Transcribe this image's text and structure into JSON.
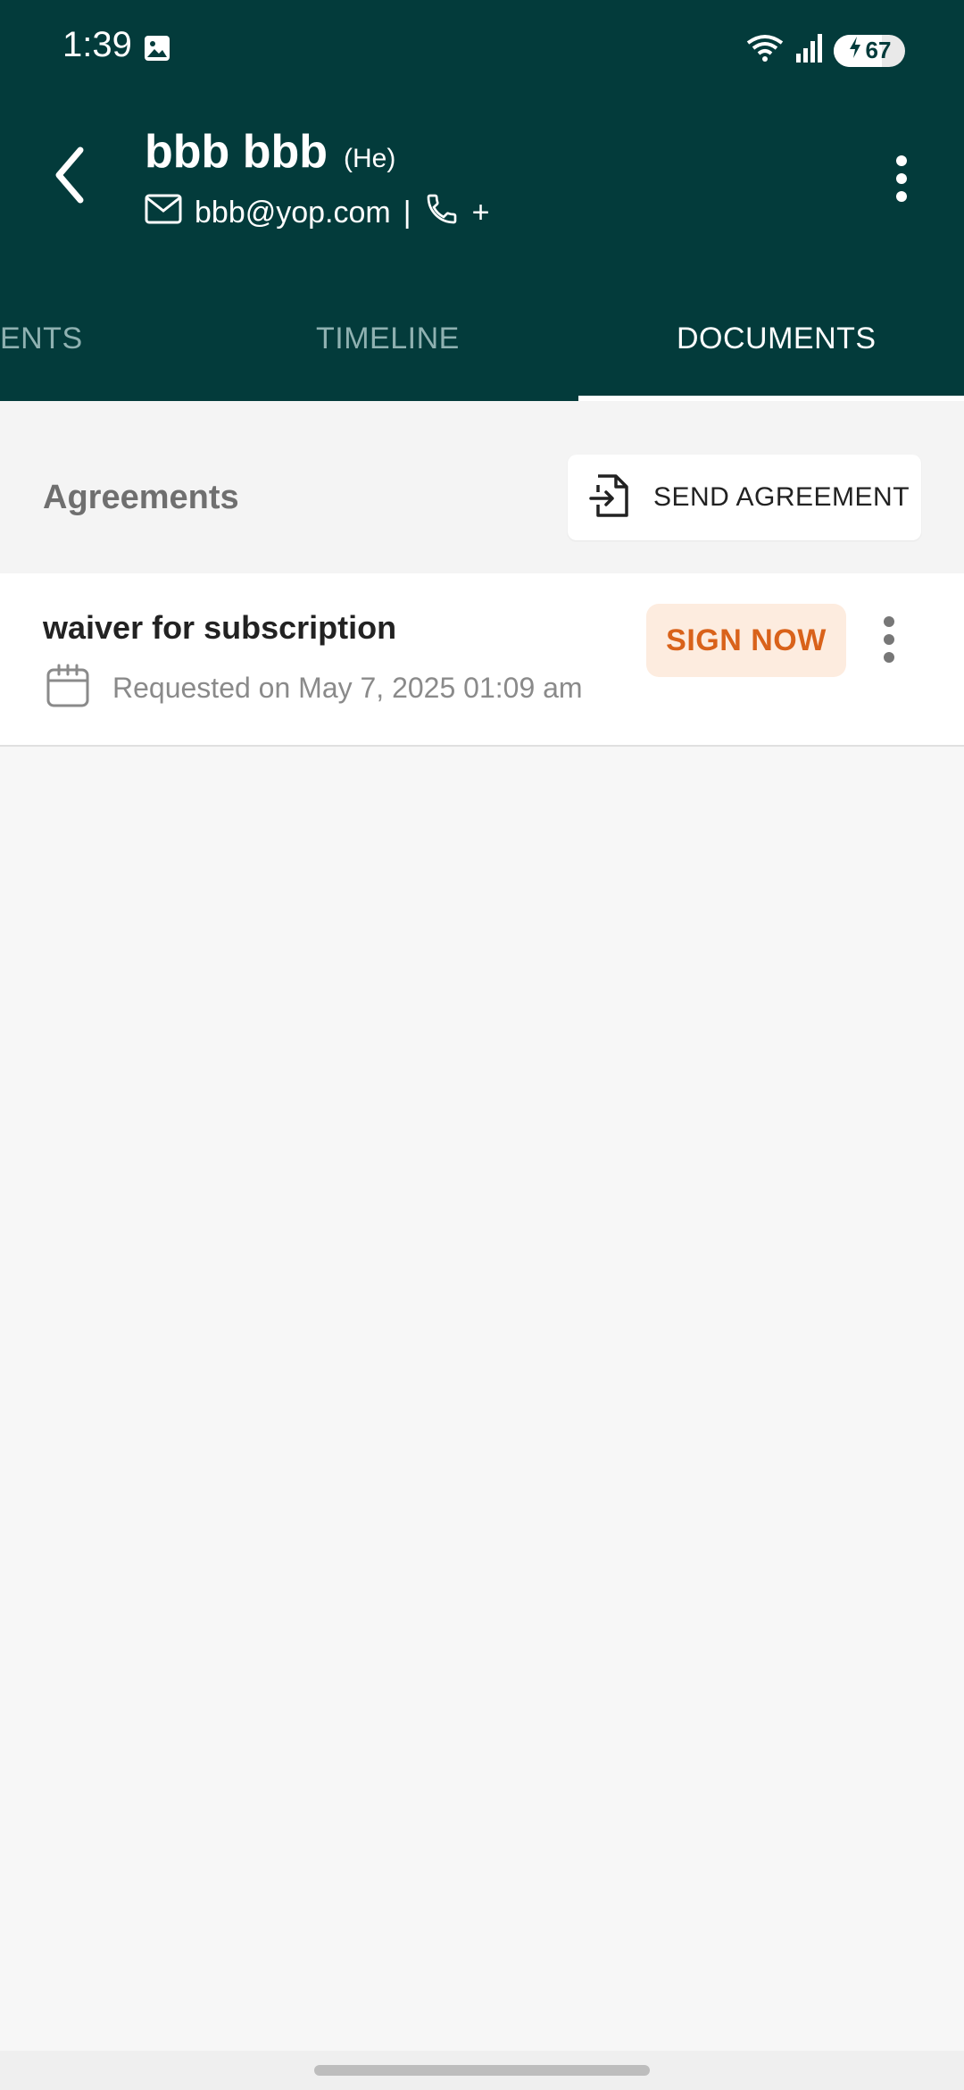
{
  "status_bar": {
    "time": "1:39",
    "battery": "67",
    "battery_level_percent": 67,
    "icons": [
      "image-icon",
      "wifi-icon",
      "signal-icon",
      "battery-charging-icon"
    ]
  },
  "header": {
    "name": "bbb bbb",
    "pronoun": "(He)",
    "email": "bbb@yop.com",
    "separator": "|",
    "phone": "+",
    "background_color": "#033b3b"
  },
  "tabs": [
    {
      "label": "IENTS",
      "active": false
    },
    {
      "label": "TIMELINE",
      "active": false
    },
    {
      "label": "DOCUMENTS",
      "active": true
    }
  ],
  "section": {
    "title": "Agreements",
    "send_button_label": "SEND AGREEMENT"
  },
  "agreements": [
    {
      "title": "waiver for subscription",
      "meta": "Requested on May 7, 2025 01:09 am",
      "action_label": "SIGN NOW",
      "action_color": "#d9621a"
    }
  ]
}
